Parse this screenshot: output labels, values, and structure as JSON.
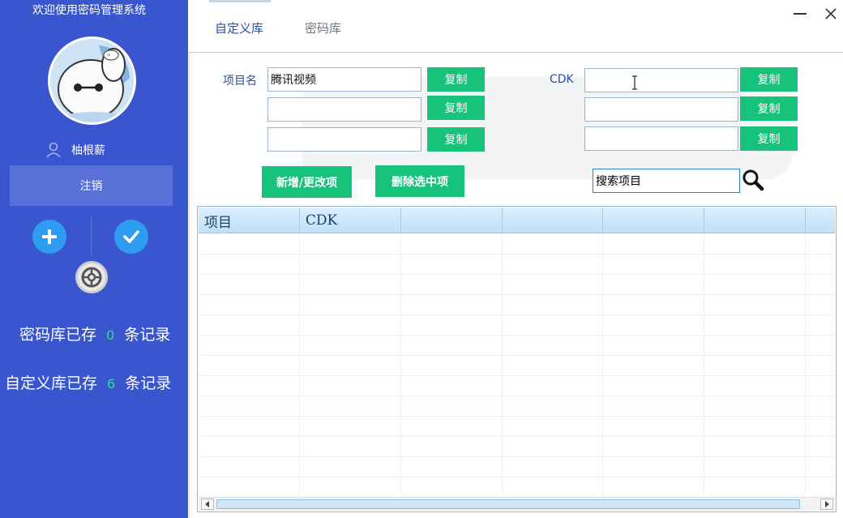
{
  "app": {
    "welcome": "欢迎使用密码管理系统"
  },
  "sidebar": {
    "username": "柚根薪",
    "logout_label": "注销",
    "stats": [
      {
        "prefix": "密码库已存",
        "count": "0",
        "suffix": "条记录"
      },
      {
        "prefix": "自定义库已存",
        "count": "6",
        "suffix": "条记录"
      }
    ],
    "icons": {
      "add": "plus-circle-icon",
      "confirm": "check-circle-icon",
      "settings": "gear-icon",
      "user": "user-icon"
    }
  },
  "tabs": [
    {
      "label": "自定义库",
      "active": true
    },
    {
      "label": "密码库",
      "active": false
    }
  ],
  "form": {
    "project_label": "项目名",
    "cdk_label": "CDK",
    "project_fields": [
      "腾讯视频",
      "",
      ""
    ],
    "cdk_fields": [
      "",
      "",
      ""
    ],
    "copy_label": "复制",
    "add_update_label": "新增/更改项",
    "delete_label": "删除选中项",
    "search_value": "搜索项目"
  },
  "table": {
    "columns": [
      "项目",
      "CDK",
      "",
      "",
      "",
      "",
      ""
    ],
    "rows": []
  },
  "colors": {
    "sidebar": "#3a56cf",
    "accent_green": "#17c27b",
    "count_green": "#35d69a",
    "icon_blue": "#2e9cf0"
  }
}
